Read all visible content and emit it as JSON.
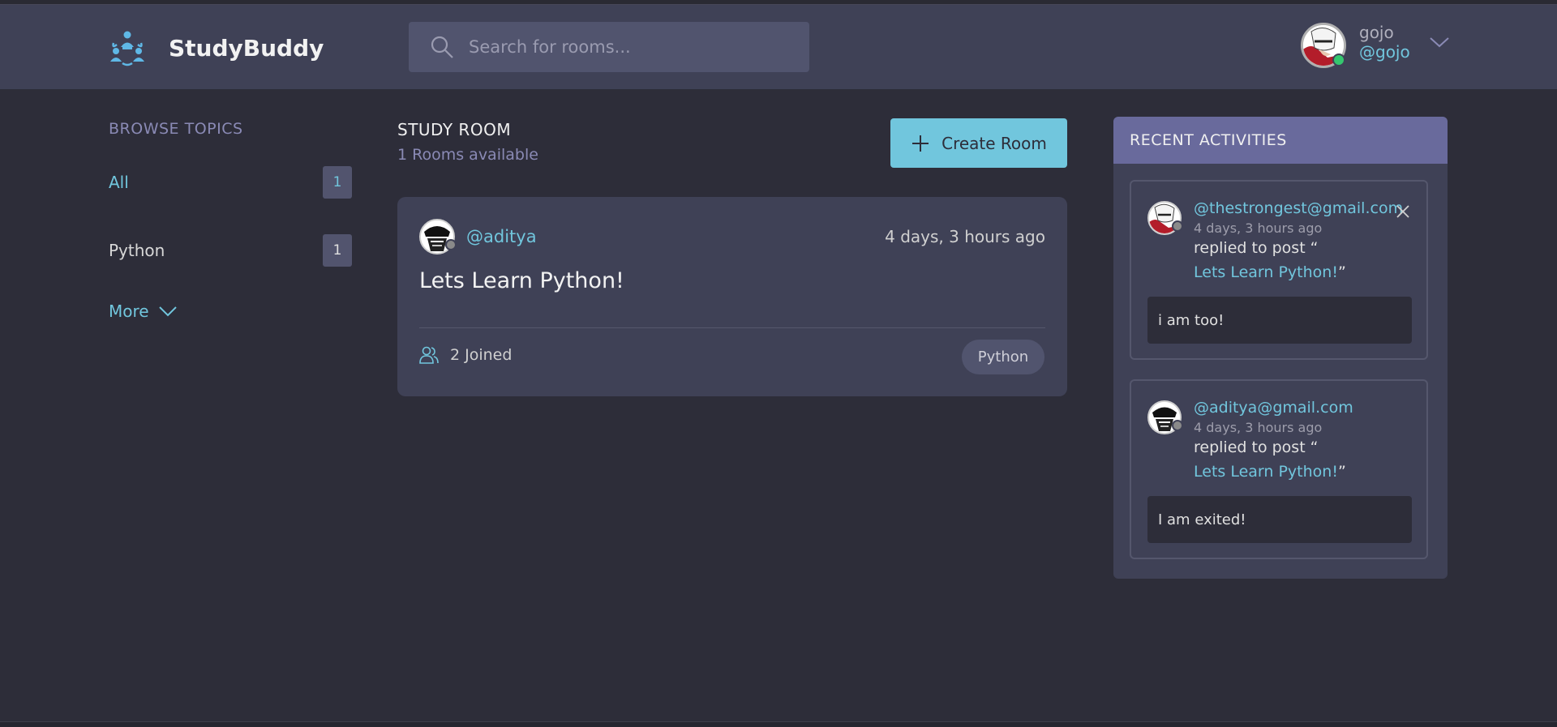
{
  "app": {
    "name": "StudyBuddy"
  },
  "search": {
    "placeholder": "Search for rooms..."
  },
  "user": {
    "name": "gojo",
    "handle": "@gojo"
  },
  "sidebar": {
    "title": "BROWSE TOPICS",
    "topics": [
      {
        "label": "All",
        "count": "1"
      },
      {
        "label": "Python",
        "count": "1"
      }
    ],
    "more_label": "More"
  },
  "main": {
    "title": "STUDY ROOM",
    "subtitle": "1 Rooms available",
    "create_label": "Create Room",
    "rooms": [
      {
        "host": "@aditya",
        "time": "4 days, 3 hours ago",
        "title": "Lets Learn Python!",
        "joined": "2 Joined",
        "topic": "Python"
      }
    ]
  },
  "activities": {
    "title": "RECENT ACTIVITIES",
    "items": [
      {
        "user": "@thestrongest@gmail.com",
        "time": "4 days, 3 hours ago",
        "action": "replied to post “",
        "post": "Lets Learn Python!",
        "post_close": "”",
        "message": "i am too!"
      },
      {
        "user": "@aditya@gmail.com",
        "time": "4 days, 3 hours ago",
        "action": "replied to post “",
        "post": "Lets Learn Python!",
        "post_close": "”",
        "message": "I am exited!"
      }
    ]
  },
  "colors": {
    "accent": "#71c6dd",
    "background": "#2d2d39",
    "panel": "#3f4156",
    "header_band": "#696a9c",
    "online": "#35c76f"
  },
  "icons": [
    "studybuddy-logo-icon",
    "search-icon",
    "chevron-down-icon",
    "plus-icon",
    "users-icon",
    "close-icon"
  ]
}
